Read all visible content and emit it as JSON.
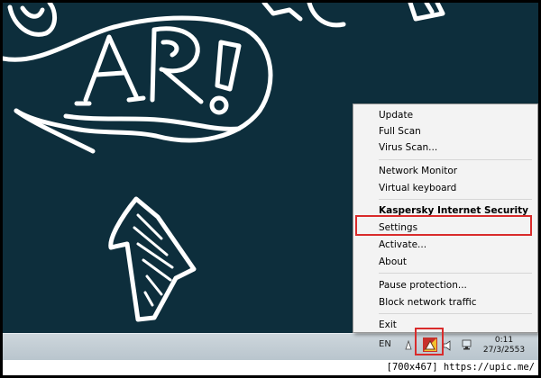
{
  "context_menu": {
    "items": [
      {
        "label": "Update"
      },
      {
        "label": "Full Scan"
      },
      {
        "label": "Virus Scan..."
      },
      {
        "label": "Network Monitor"
      },
      {
        "label": "Virtual keyboard"
      },
      {
        "label": "Kaspersky Internet Security"
      },
      {
        "label": "Settings"
      },
      {
        "label": "Activate..."
      },
      {
        "label": "About"
      },
      {
        "label": "Pause protection..."
      },
      {
        "label": "Block network traffic"
      },
      {
        "label": "Exit"
      }
    ]
  },
  "taskbar": {
    "language": "EN",
    "clock_time": "0:11",
    "clock_date": "27/3/2553"
  },
  "credit": "[700x467] https://upic.me/",
  "colors": {
    "desktop_background": "#0d2e3c",
    "highlight_box": "#d92b2b",
    "menu_background": "#f3f3f3"
  },
  "icons": [
    "kaspersky-tray-icon",
    "volume-icon",
    "network-icon",
    "flag-icon"
  ]
}
